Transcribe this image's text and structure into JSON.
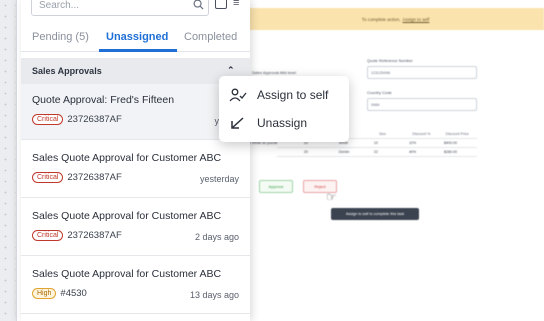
{
  "search": {
    "placeholder": "Search..."
  },
  "tabs": [
    {
      "label": "Pending (5)"
    },
    {
      "label": "Unassigned",
      "active": true
    },
    {
      "label": "Completed"
    }
  ],
  "section": {
    "title": "Sales Approvals"
  },
  "items": [
    {
      "title": "Quote Approval: Fred's Fifteen",
      "badge": "Critical",
      "id": "23726387AF",
      "time": "yester"
    },
    {
      "title": "Sales Quote Approval for Customer ABC",
      "badge": "Critical",
      "id": "23726387AF",
      "time": "yesterday"
    },
    {
      "title": "Sales Quote Approval for Customer ABC",
      "badge": "Critical",
      "id": "23726387AF",
      "time": "2 days ago"
    },
    {
      "title": "Sales Quote Approval for Customer ABC",
      "badge": "High",
      "id": "#4530",
      "time": "13 days ago"
    }
  ],
  "menu": {
    "assign_label": "Assign to self",
    "unassign_label": "Unassign"
  },
  "background": {
    "banner_text": "To complete action,",
    "banner_link": "Assign to self",
    "field1_label": "Quote Reference Number",
    "field1_value": "123125498",
    "field2_label": "Country Code",
    "field2_value": "9984",
    "field3_label": "Sales Approval Attd level",
    "table_headers": [
      "",
      "Qty",
      "",
      "Size",
      "Discount %",
      "Discount Price"
    ],
    "table_rows": [
      [
        "",
        "",
        "",
        "",
        "",
        ""
      ],
      [
        "T-White 8x puzzle",
        "20",
        "White",
        "10",
        "12%",
        "$400.00"
      ],
      [
        "",
        "20",
        "Denim",
        "22",
        "40%",
        "$280.00"
      ]
    ],
    "approve_label": "Approve",
    "reject_label": "Reject",
    "tooltip": "Assign to self to complete this task"
  }
}
